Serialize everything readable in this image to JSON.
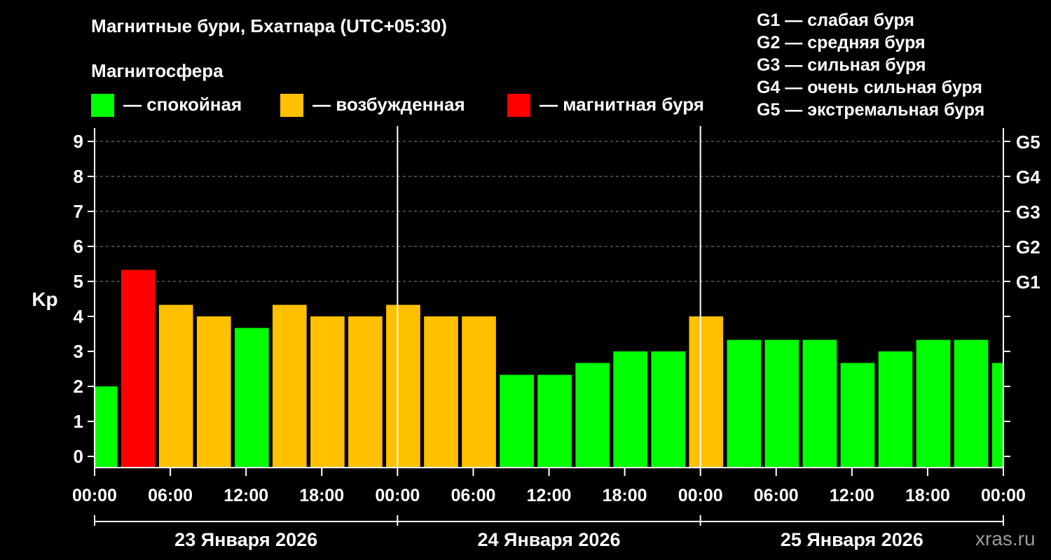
{
  "title": "Магнитные бури, Бхатпара (UTC+05:30)",
  "subtitle": "Магнитосфера",
  "legend": [
    {
      "label": "— спокойная",
      "color": "#00ff00"
    },
    {
      "label": "— возбужденная",
      "color": "#ffc000"
    },
    {
      "label": "— магнитная буря",
      "color": "#ff0000"
    }
  ],
  "g_legend": [
    "G1 — слабая буря",
    "G2 — средняя буря",
    "G3 — сильная буря",
    "G4 — очень сильная буря",
    "G5 — экстремальная буря"
  ],
  "credit": "xras.ru",
  "colors": {
    "background": "#000000",
    "calm": "#00ff00",
    "disturbed": "#ffc000",
    "storm": "#ff0000",
    "grid": "#888888",
    "text": "#ffffff"
  },
  "chart_data": {
    "type": "bar",
    "ylabel": "Kp",
    "ylim": [
      0,
      9
    ],
    "yticks": [
      "0",
      "1",
      "2",
      "3",
      "4",
      "5",
      "6",
      "7",
      "8",
      "9"
    ],
    "y2ticks": [
      {
        "label": "G1",
        "kp": 5
      },
      {
        "label": "G2",
        "kp": 6
      },
      {
        "label": "G3",
        "kp": 7
      },
      {
        "label": "G4",
        "kp": 8
      },
      {
        "label": "G5",
        "kp": 9
      }
    ],
    "xlim_hours": [
      0,
      72
    ],
    "xticks": [
      {
        "label": "00:00",
        "hour": 0
      },
      {
        "label": "06:00",
        "hour": 6
      },
      {
        "label": "12:00",
        "hour": 12
      },
      {
        "label": "18:00",
        "hour": 18
      },
      {
        "label": "00:00",
        "hour": 24
      },
      {
        "label": "06:00",
        "hour": 30
      },
      {
        "label": "12:00",
        "hour": 36
      },
      {
        "label": "18:00",
        "hour": 42
      },
      {
        "label": "00:00",
        "hour": 48
      },
      {
        "label": "06:00",
        "hour": 54
      },
      {
        "label": "12:00",
        "hour": 60
      },
      {
        "label": "18:00",
        "hour": 66
      },
      {
        "label": "00:00",
        "hour": 72
      }
    ],
    "days": [
      {
        "label": "23 Января 2026",
        "start_hour": 0,
        "end_hour": 24
      },
      {
        "label": "24 Января 2026",
        "start_hour": 24,
        "end_hour": 48
      },
      {
        "label": "25 Января 2026",
        "start_hour": 48,
        "end_hour": 72
      }
    ],
    "grid": true,
    "bars": [
      {
        "start_hour": 0.0,
        "end_hour": 1.8,
        "kp": 2.0,
        "level": "calm"
      },
      {
        "start_hour": 2.1,
        "end_hour": 4.8,
        "kp": 5.33,
        "level": "storm"
      },
      {
        "start_hour": 5.1,
        "end_hour": 7.8,
        "kp": 4.33,
        "level": "disturbed"
      },
      {
        "start_hour": 8.1,
        "end_hour": 10.8,
        "kp": 4.0,
        "level": "disturbed"
      },
      {
        "start_hour": 11.1,
        "end_hour": 13.8,
        "kp": 3.67,
        "level": "calm"
      },
      {
        "start_hour": 14.1,
        "end_hour": 16.8,
        "kp": 4.33,
        "level": "disturbed"
      },
      {
        "start_hour": 17.1,
        "end_hour": 19.8,
        "kp": 4.0,
        "level": "disturbed"
      },
      {
        "start_hour": 20.1,
        "end_hour": 22.8,
        "kp": 4.0,
        "level": "disturbed"
      },
      {
        "start_hour": 23.1,
        "end_hour": 25.8,
        "kp": 4.33,
        "level": "disturbed"
      },
      {
        "start_hour": 26.1,
        "end_hour": 28.8,
        "kp": 4.0,
        "level": "disturbed"
      },
      {
        "start_hour": 29.1,
        "end_hour": 31.8,
        "kp": 4.0,
        "level": "disturbed"
      },
      {
        "start_hour": 32.1,
        "end_hour": 34.8,
        "kp": 2.33,
        "level": "calm"
      },
      {
        "start_hour": 35.1,
        "end_hour": 37.8,
        "kp": 2.33,
        "level": "calm"
      },
      {
        "start_hour": 38.1,
        "end_hour": 40.8,
        "kp": 2.67,
        "level": "calm"
      },
      {
        "start_hour": 41.1,
        "end_hour": 43.8,
        "kp": 3.0,
        "level": "calm"
      },
      {
        "start_hour": 44.1,
        "end_hour": 46.8,
        "kp": 3.0,
        "level": "calm"
      },
      {
        "start_hour": 47.1,
        "end_hour": 49.8,
        "kp": 4.0,
        "level": "disturbed"
      },
      {
        "start_hour": 50.1,
        "end_hour": 52.8,
        "kp": 3.33,
        "level": "calm"
      },
      {
        "start_hour": 53.1,
        "end_hour": 55.8,
        "kp": 3.33,
        "level": "calm"
      },
      {
        "start_hour": 56.1,
        "end_hour": 58.8,
        "kp": 3.33,
        "level": "calm"
      },
      {
        "start_hour": 59.1,
        "end_hour": 61.8,
        "kp": 2.67,
        "level": "calm"
      },
      {
        "start_hour": 62.1,
        "end_hour": 64.8,
        "kp": 3.0,
        "level": "calm"
      },
      {
        "start_hour": 65.1,
        "end_hour": 67.8,
        "kp": 3.33,
        "level": "calm"
      },
      {
        "start_hour": 68.1,
        "end_hour": 70.8,
        "kp": 3.33,
        "level": "calm"
      },
      {
        "start_hour": 71.1,
        "end_hour": 72.0,
        "kp": 2.67,
        "level": "calm"
      }
    ]
  }
}
